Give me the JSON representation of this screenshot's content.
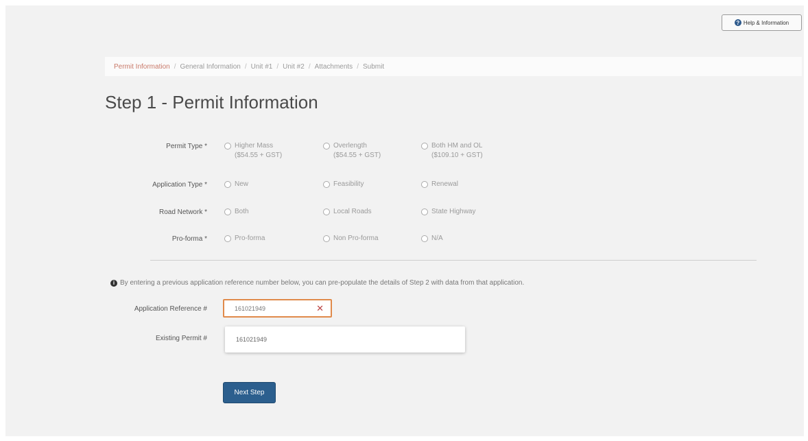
{
  "help_button": {
    "label": "Help & Information",
    "icon": "question-circle-icon"
  },
  "breadcrumb": [
    {
      "label": "Permit Information",
      "active": true
    },
    {
      "label": "General Information",
      "active": false
    },
    {
      "label": "Unit #1",
      "active": false
    },
    {
      "label": "Unit #2",
      "active": false
    },
    {
      "label": "Attachments",
      "active": false
    },
    {
      "label": "Submit",
      "active": false
    }
  ],
  "page_title": "Step 1 - Permit Information",
  "fields": {
    "permit_type": {
      "label": "Permit Type *",
      "options": [
        {
          "line1": "Higher Mass",
          "line2": "($54.55 + GST)"
        },
        {
          "line1": "Overlength",
          "line2": "($54.55 + GST)"
        },
        {
          "line1": "Both HM and OL",
          "line2": "($109.10 + GST)"
        }
      ]
    },
    "application_type": {
      "label": "Application Type *",
      "options": [
        "New",
        "Feasibility",
        "Renewal"
      ]
    },
    "road_network": {
      "label": "Road Network *",
      "options": [
        "Both",
        "Local Roads",
        "State Highway"
      ]
    },
    "pro_forma": {
      "label": "Pro-forma *",
      "options": [
        "Pro-forma",
        "Non Pro-forma",
        "N/A"
      ]
    }
  },
  "info_text": "By entering a previous application reference number below, you can pre-populate the details of Step 2 with data from that application.",
  "application_reference": {
    "label": "Application Reference #",
    "value": "161021949",
    "clear_icon": "close-icon"
  },
  "existing_permit": {
    "label": "Existing Permit #"
  },
  "dropdown_option": "161021949",
  "next_button": "Next Step",
  "colors": {
    "primary": "#2c5f8e",
    "focus_border": "#e08a4a",
    "breadcrumb_active": "#c97a6a"
  }
}
